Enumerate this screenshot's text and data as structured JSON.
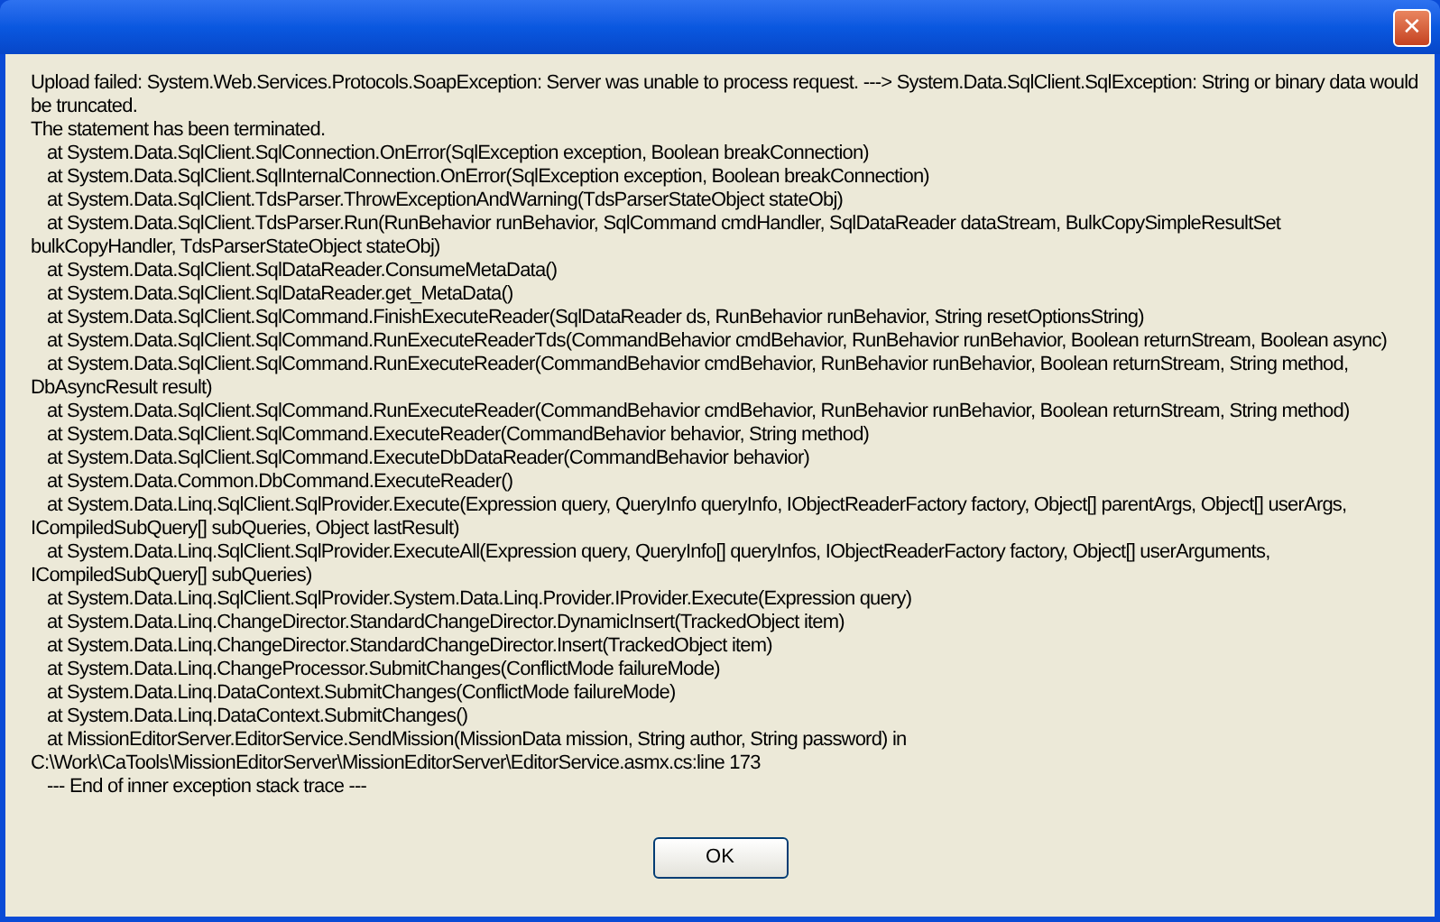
{
  "window": {
    "close_button": "✕"
  },
  "message": [
    {
      "text": "Upload failed: System.Web.Services.Protocols.SoapException: Server was unable to process request. ---> System.Data.SqlClient.SqlException: String or binary data would be truncated.",
      "indent": false
    },
    {
      "text": "The statement has been terminated.",
      "indent": false
    },
    {
      "text": "at System.Data.SqlClient.SqlConnection.OnError(SqlException exception, Boolean breakConnection)",
      "indent": true
    },
    {
      "text": "at System.Data.SqlClient.SqlInternalConnection.OnError(SqlException exception, Boolean breakConnection)",
      "indent": true
    },
    {
      "text": "at System.Data.SqlClient.TdsParser.ThrowExceptionAndWarning(TdsParserStateObject stateObj)",
      "indent": true
    },
    {
      "text": "at System.Data.SqlClient.TdsParser.Run(RunBehavior runBehavior, SqlCommand cmdHandler, SqlDataReader dataStream, BulkCopySimpleResultSet bulkCopyHandler, TdsParserStateObject stateObj)",
      "indent": true
    },
    {
      "text": "at System.Data.SqlClient.SqlDataReader.ConsumeMetaData()",
      "indent": true
    },
    {
      "text": "at System.Data.SqlClient.SqlDataReader.get_MetaData()",
      "indent": true
    },
    {
      "text": "at System.Data.SqlClient.SqlCommand.FinishExecuteReader(SqlDataReader ds, RunBehavior runBehavior, String resetOptionsString)",
      "indent": true
    },
    {
      "text": "at System.Data.SqlClient.SqlCommand.RunExecuteReaderTds(CommandBehavior cmdBehavior, RunBehavior runBehavior, Boolean returnStream, Boolean async)",
      "indent": true
    },
    {
      "text": "at System.Data.SqlClient.SqlCommand.RunExecuteReader(CommandBehavior cmdBehavior, RunBehavior runBehavior, Boolean returnStream, String method, DbAsyncResult result)",
      "indent": true
    },
    {
      "text": "at System.Data.SqlClient.SqlCommand.RunExecuteReader(CommandBehavior cmdBehavior, RunBehavior runBehavior, Boolean returnStream, String method)",
      "indent": true
    },
    {
      "text": "at System.Data.SqlClient.SqlCommand.ExecuteReader(CommandBehavior behavior, String method)",
      "indent": true
    },
    {
      "text": "at System.Data.SqlClient.SqlCommand.ExecuteDbDataReader(CommandBehavior behavior)",
      "indent": true
    },
    {
      "text": "at System.Data.Common.DbCommand.ExecuteReader()",
      "indent": true
    },
    {
      "text": "at System.Data.Linq.SqlClient.SqlProvider.Execute(Expression query, QueryInfo queryInfo, IObjectReaderFactory factory, Object[] parentArgs, Object[] userArgs, ICompiledSubQuery[] subQueries, Object lastResult)",
      "indent": true
    },
    {
      "text": "at System.Data.Linq.SqlClient.SqlProvider.ExecuteAll(Expression query, QueryInfo[] queryInfos, IObjectReaderFactory factory, Object[] userArguments, ICompiledSubQuery[] subQueries)",
      "indent": true
    },
    {
      "text": "at System.Data.Linq.SqlClient.SqlProvider.System.Data.Linq.Provider.IProvider.Execute(Expression query)",
      "indent": true
    },
    {
      "text": "at System.Data.Linq.ChangeDirector.StandardChangeDirector.DynamicInsert(TrackedObject item)",
      "indent": true
    },
    {
      "text": "at System.Data.Linq.ChangeDirector.StandardChangeDirector.Insert(TrackedObject item)",
      "indent": true
    },
    {
      "text": "at System.Data.Linq.ChangeProcessor.SubmitChanges(ConflictMode failureMode)",
      "indent": true
    },
    {
      "text": "at System.Data.Linq.DataContext.SubmitChanges(ConflictMode failureMode)",
      "indent": true
    },
    {
      "text": "at System.Data.Linq.DataContext.SubmitChanges()",
      "indent": true
    },
    {
      "text": "at MissionEditorServer.EditorService.SendMission(MissionData mission, String author, String password) in",
      "indent": true
    },
    {
      "text": "C:\\Work\\CaTools\\MissionEditorServer\\MissionEditorServer\\EditorService.asmx.cs:line 173",
      "indent": false
    },
    {
      "text": "--- End of inner exception stack trace ---",
      "indent": true
    }
  ],
  "buttons": [
    {
      "label": "OK"
    }
  ]
}
